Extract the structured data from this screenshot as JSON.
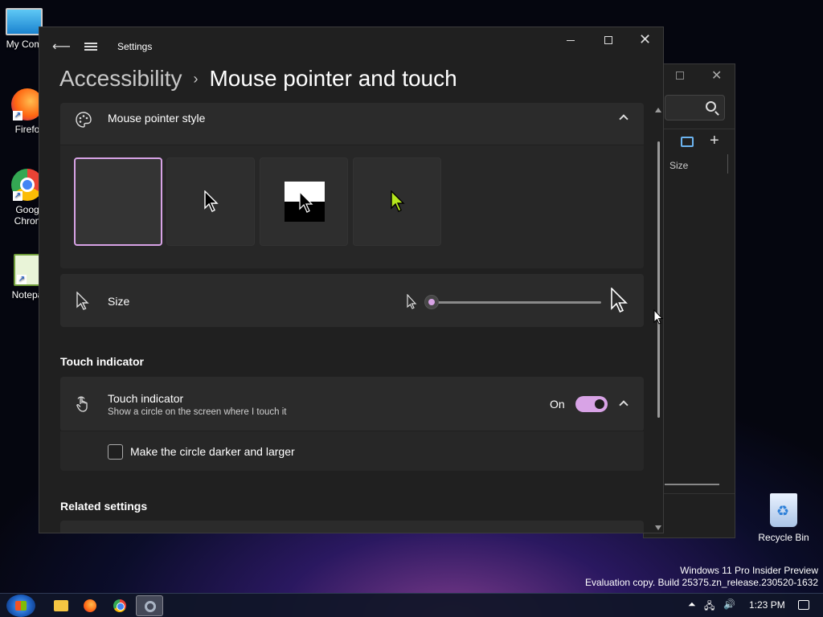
{
  "desktop": {
    "icons": [
      {
        "label": "My Com"
      },
      {
        "label": "Firefo"
      },
      {
        "label_line1": "Goog",
        "label_line2": "Chron"
      },
      {
        "label": "Notepa"
      }
    ],
    "recycle_bin": "Recycle Bin",
    "watermark_line1": "Windows 11 Pro Insider Preview",
    "watermark_line2": "Evaluation copy. Build 25375.zn_release.230520-1632"
  },
  "background_window": {
    "column_header": "Size"
  },
  "settings": {
    "app_title": "Settings",
    "breadcrumb_parent": "Accessibility",
    "breadcrumb_separator": "›",
    "page_title": "Mouse pointer and touch",
    "mouse_pointer_style": {
      "label": "Mouse pointer style",
      "options": [
        {
          "name": "white",
          "selected": true
        },
        {
          "name": "black",
          "selected": false
        },
        {
          "name": "inverted",
          "selected": false
        },
        {
          "name": "custom",
          "selected": false,
          "color": "#b5e61d"
        }
      ]
    },
    "size": {
      "label": "Size",
      "value_fraction": 0
    },
    "touch_section_title": "Touch indicator",
    "touch_indicator": {
      "label": "Touch indicator",
      "description": "Show a circle on the screen where I touch it",
      "toggle_label": "On",
      "toggle_on": true,
      "darker_option": "Make the circle darker and larger",
      "darker_checked": false
    },
    "related_settings_title": "Related settings",
    "accent_color": "#d8a3e6"
  },
  "taskbar": {
    "clock": "1:23 PM",
    "tray_up": "⏶",
    "tray_net": "🖧",
    "tray_volume": "🔊"
  }
}
